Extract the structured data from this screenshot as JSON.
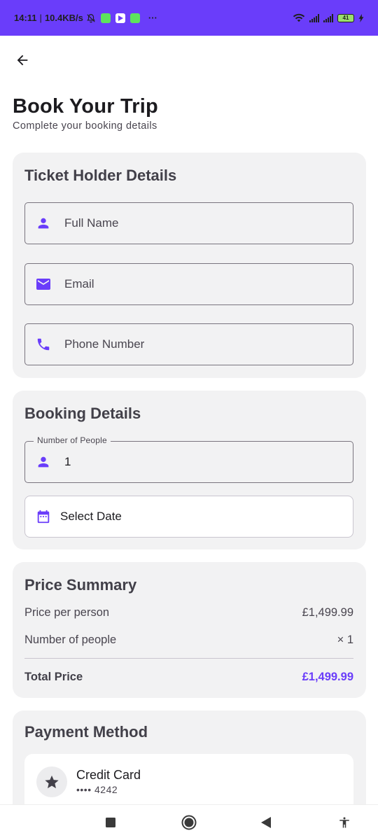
{
  "status_bar": {
    "time": "14:11",
    "speed": "10.4KB/s",
    "battery": "41",
    "overflow": "···",
    "icons": [
      "mute-icon",
      "app-notification-icon",
      "play-icon",
      "app-notification-icon",
      "wifi-icon",
      "signal-icon",
      "signal-icon",
      "battery-icon",
      "charging-icon"
    ]
  },
  "app_bar": {
    "back_icon": "arrow-back-icon"
  },
  "header": {
    "title": "Book Your Trip",
    "subtitle": "Complete your booking details"
  },
  "ticket_holder": {
    "title": "Ticket Holder Details",
    "full_name_placeholder": "Full Name",
    "email_placeholder": "Email",
    "phone_placeholder": "Phone Number"
  },
  "booking": {
    "title": "Booking Details",
    "people_label": "Number of People",
    "people_value": "1",
    "date_label": "Select Date"
  },
  "price_summary": {
    "title": "Price Summary",
    "price_per_person_label": "Price per person",
    "price_per_person_value": "£1,499.99",
    "num_people_label": "Number of people",
    "num_people_value": "× 1",
    "total_label": "Total Price",
    "total_value": "£1,499.99"
  },
  "payment": {
    "title": "Payment Method",
    "method_name": "Credit Card",
    "method_detail": "•••• 4242"
  },
  "colors": {
    "accent": "#6a3dfa",
    "card_bg": "#f2f2f3",
    "text_dark": "#1c1b1f"
  },
  "nav_bar": {
    "icons": [
      "recents-square-icon",
      "home-circle-icon",
      "back-triangle-icon",
      "accessibility-icon"
    ]
  }
}
